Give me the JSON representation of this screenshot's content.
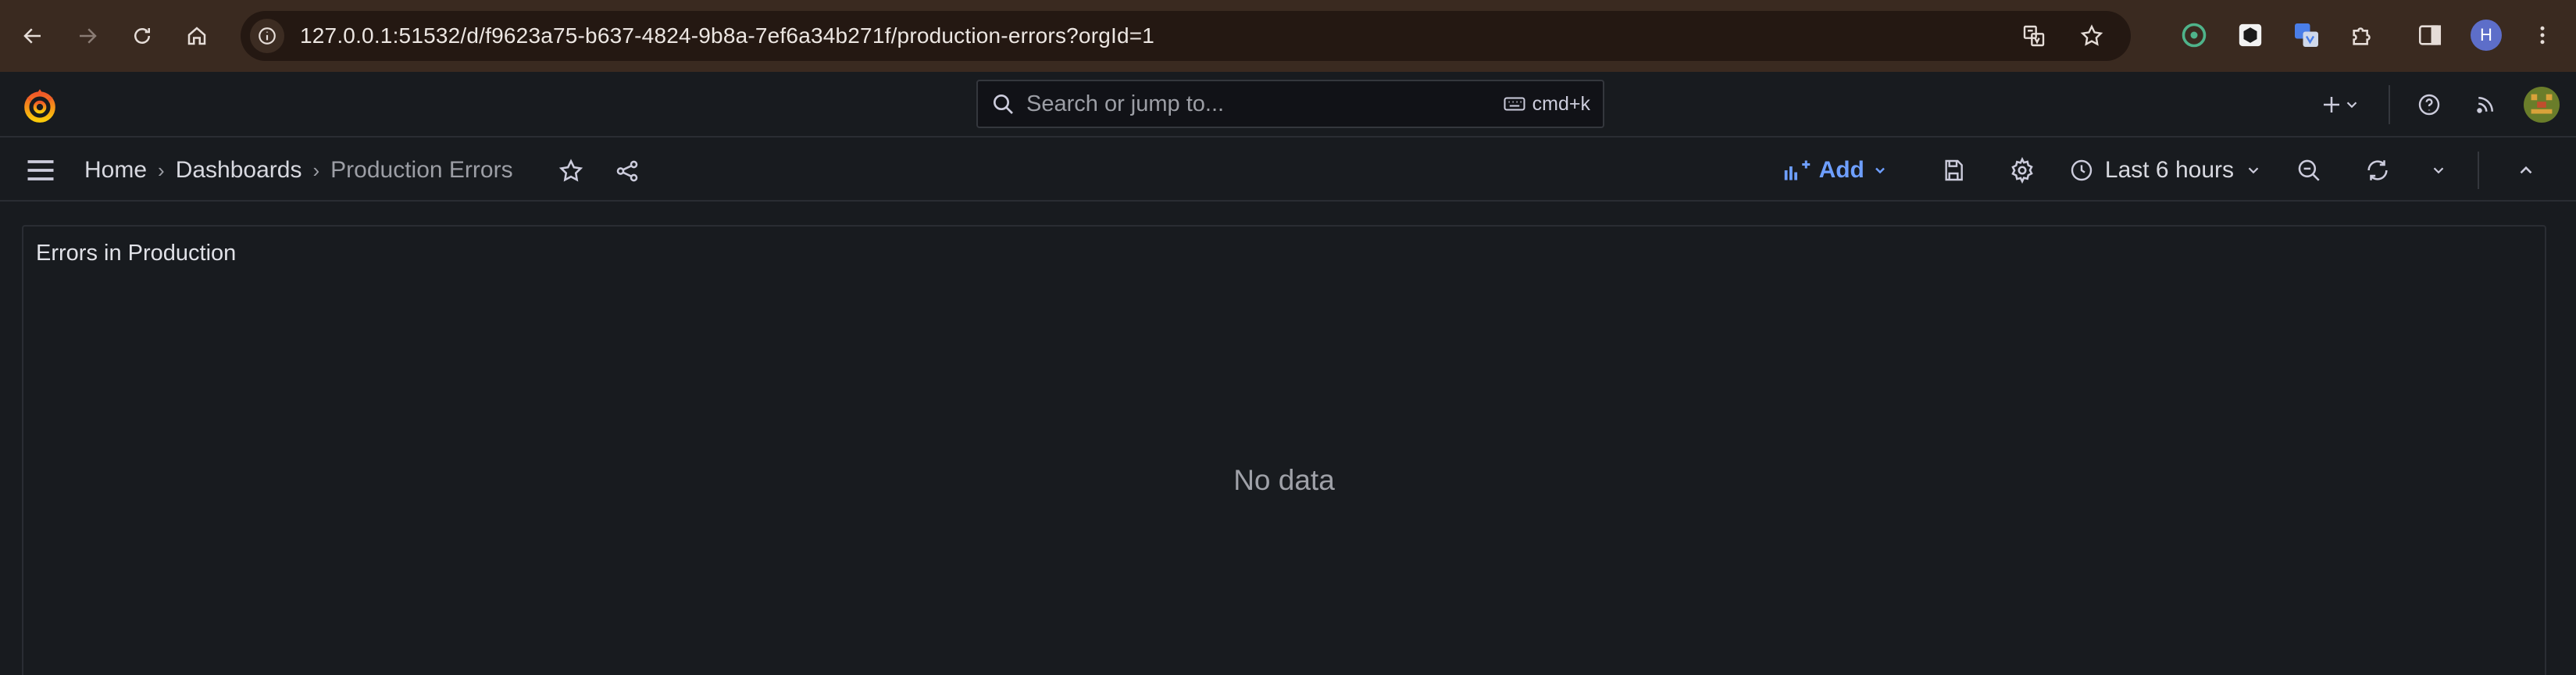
{
  "browser": {
    "url": "127.0.0.1:51532/d/f9623a75-b637-4824-9b8a-7ef6a34b271f/production-errors?orgId=1",
    "profile_initial": "H"
  },
  "topbar": {
    "search_placeholder": "Search or jump to...",
    "shortcut": "cmd+k"
  },
  "breadcrumb": {
    "items": [
      "Home",
      "Dashboards",
      "Production Errors"
    ]
  },
  "toolbar": {
    "add_label": "Add",
    "time_range": "Last 6 hours"
  },
  "panel": {
    "title": "Errors in Production",
    "empty_text": "No data"
  },
  "colors": {
    "accent": "#6e9fff",
    "background": "#181b1f",
    "chrome": "#3a2a20"
  }
}
